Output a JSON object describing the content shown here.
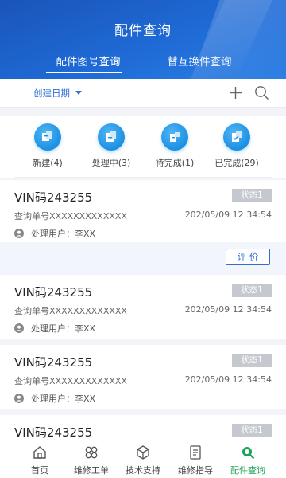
{
  "header": {
    "title": "配件查询",
    "tabs": [
      {
        "label": "配件图号查询",
        "active": true
      },
      {
        "label": "替互换件查询",
        "active": false
      }
    ]
  },
  "filter": {
    "sort_label": "创建日期",
    "icons": [
      "chevron-down-icon",
      "plus-icon",
      "search-icon"
    ]
  },
  "summary": [
    {
      "label": "新建(4)",
      "icon": "new-icon"
    },
    {
      "label": "处理中(3)",
      "icon": "processing-icon"
    },
    {
      "label": "待完成(1)",
      "icon": "pending-icon"
    },
    {
      "label": "已完成(29)",
      "icon": "completed-icon"
    }
  ],
  "cards": [
    {
      "vin": "VIN码243255",
      "status": "状态1",
      "query_no": "查询单号XXXXXXXXXXXXX",
      "time": "202/05/09 12:34:54",
      "user": "处理用户：李XX",
      "action": "评 价"
    },
    {
      "vin": "VIN码243255",
      "status": "状态1",
      "query_no": "查询单号XXXXXXXXXXXXX",
      "time": "202/05/09 12:34:54",
      "user": "处理用户：李XX"
    },
    {
      "vin": "VIN码243255",
      "status": "状态1",
      "query_no": "查询单号XXXXXXXXXXXXX",
      "time": "202/05/09 12:34:54",
      "user": "处理用户：李XX"
    },
    {
      "vin": "VIN码243255",
      "status": "状态1"
    }
  ],
  "bottom_nav": [
    {
      "label": "首页",
      "icon": "home-icon"
    },
    {
      "label": "维修工单",
      "icon": "work-order-icon"
    },
    {
      "label": "技术支持",
      "icon": "box-icon"
    },
    {
      "label": "维修指导",
      "icon": "document-icon"
    },
    {
      "label": "配件查询",
      "icon": "parts-search-icon",
      "active": true
    }
  ],
  "colors": {
    "primary": "#2f6fd6",
    "header_start": "#1a55b8",
    "active_nav": "#1ba35a",
    "badge_bg": "#c5c9cf"
  }
}
